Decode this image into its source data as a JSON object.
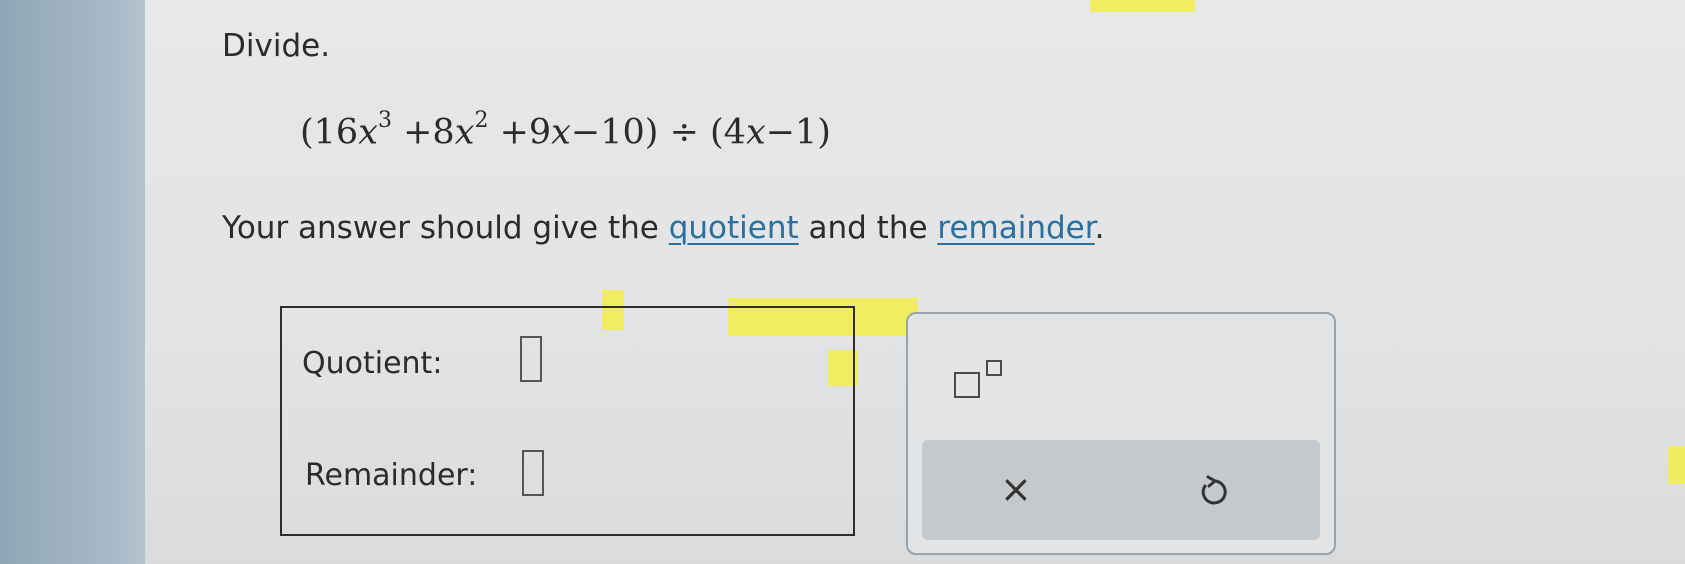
{
  "instruction": "Divide.",
  "equation": {
    "open1": "(16",
    "var1": "x",
    "exp1": "3",
    "t2": " +8",
    "var2": "x",
    "exp2": "2",
    "t3": " +9",
    "var3": "x",
    "t4": "−10) ÷ (4",
    "var4": "x",
    "t5": "−1)"
  },
  "prompt": {
    "before": "Your answer should give the ",
    "quotient_term": "quotient",
    "middle": " and the ",
    "remainder_term": "remainder",
    "after": "."
  },
  "fields": {
    "quotient_label": "Quotient:",
    "remainder_label": "Remainder:"
  },
  "toolbar": {
    "exponent_icon": "superscript-template-icon",
    "clear_icon": "x-icon",
    "clear_glyph": "×",
    "undo_icon": "undo-icon"
  },
  "colors": {
    "link": "#2a6f9e",
    "highlight": "#f2ef4a"
  }
}
